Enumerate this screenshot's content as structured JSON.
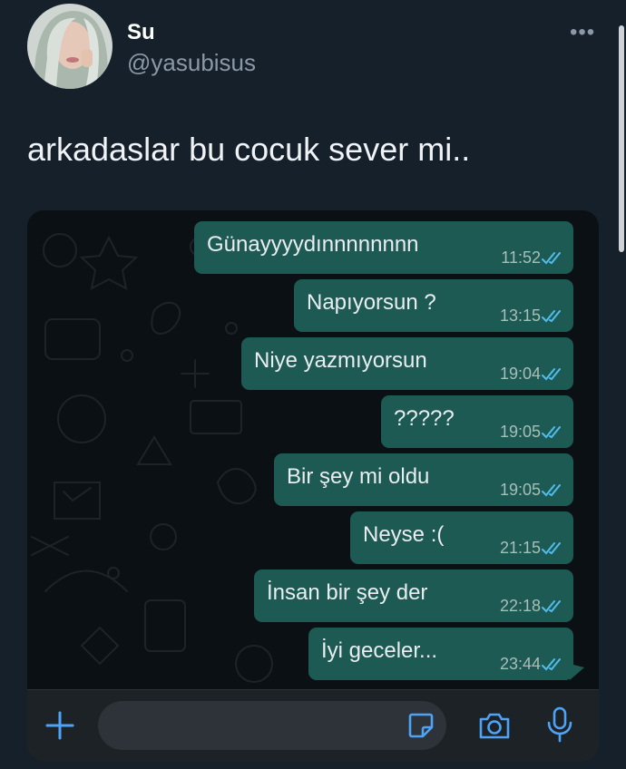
{
  "tweet": {
    "author_name": "Su",
    "author_handle": "@yasubisus",
    "text": "arkadaslar bu cocuk sever mi.."
  },
  "chat": {
    "messages": [
      {
        "text": "Günayyyydınnnnnnnn",
        "time": "11:52",
        "status": "read"
      },
      {
        "text": "Napıyorsun ?",
        "time": "13:15",
        "status": "read"
      },
      {
        "text": "Niye yazmıyorsun",
        "time": "19:04",
        "status": "read"
      },
      {
        "text": "?????",
        "time": "19:05",
        "status": "read"
      },
      {
        "text": "Bir şey mi oldu",
        "time": "19:05",
        "status": "read"
      },
      {
        "text": "Neyse :(",
        "time": "21:15",
        "status": "read"
      },
      {
        "text": "İnsan bir şey der",
        "time": "22:18",
        "status": "read"
      },
      {
        "text": "İyi geceler...",
        "time": "23:44",
        "status": "read"
      }
    ],
    "composer": {
      "icons": [
        "plus-icon",
        "sticker-icon",
        "camera-icon",
        "microphone-icon"
      ]
    }
  },
  "colors": {
    "background": "#15202b",
    "bubble": "#1d5a54",
    "read_ticks": "#53bdeb",
    "accent": "#4fa3f7"
  }
}
